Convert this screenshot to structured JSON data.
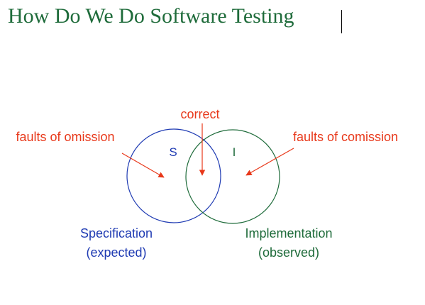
{
  "slide": {
    "title": "How Do We Do Software Testing"
  },
  "venn": {
    "spec_letter": "S",
    "impl_letter": "I",
    "correct_label": "correct",
    "omission_label": "faults of omission",
    "comission_label": "faults of comission",
    "spec_name": "Specification",
    "spec_note": "(expected)",
    "impl_name": "Implementation",
    "impl_note": "(observed)"
  },
  "colors": {
    "title": "#1e6b3a",
    "spec": "#1f3bb3",
    "impl": "#1e6b3a",
    "annotation": "#e8381a"
  }
}
